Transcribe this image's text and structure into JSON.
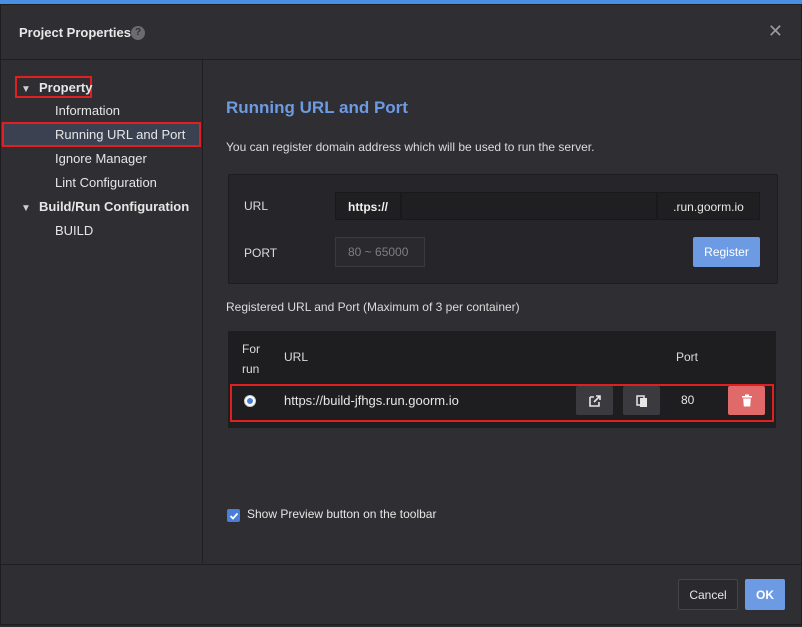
{
  "dialog": {
    "title": "Project Properties",
    "help_icon": "question-mark-icon",
    "help_glyph": "?",
    "close_glyph": "✕"
  },
  "sidebar": {
    "items": [
      {
        "label": "Property",
        "level": 0,
        "expanded": true
      },
      {
        "label": "Information",
        "level": 1
      },
      {
        "label": "Running URL and Port",
        "level": 1,
        "selected": true
      },
      {
        "label": "Ignore Manager",
        "level": 1
      },
      {
        "label": "Lint Configuration",
        "level": 1
      },
      {
        "label": "Build/Run Configuration",
        "level": 0,
        "expanded": true
      },
      {
        "label": "BUILD",
        "level": 1
      }
    ]
  },
  "main": {
    "heading": "Running URL and Port",
    "description": "You can register domain address which will be used to run the server.",
    "url_label": "URL",
    "url_prefix": "https://",
    "url_value": "",
    "url_suffix": ".run.goorm.io",
    "port_label": "PORT",
    "port_placeholder": "80 ~ 65000",
    "register_label": "Register",
    "registered_title": "Registered URL and Port (Maximum of 3 per container)",
    "table": {
      "col_for_run": "For run",
      "col_url": "URL",
      "col_port": "Port",
      "rows": [
        {
          "selected": true,
          "url": "https://build-jfhgs.run.goorm.io",
          "port": "80"
        }
      ]
    },
    "show_preview_label": "Show Preview button on the toolbar",
    "show_preview_checked": true
  },
  "footer": {
    "cancel_label": "Cancel",
    "ok_label": "OK"
  },
  "colors": {
    "accent": "#6d9be3",
    "danger": "#e06a6a",
    "highlight": "#e02020"
  }
}
